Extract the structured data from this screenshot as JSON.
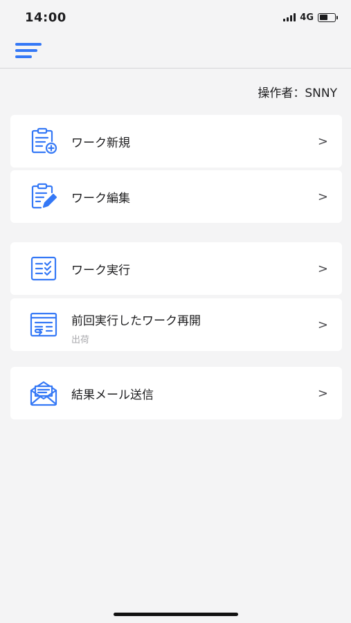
{
  "status_bar": {
    "time": "14:00",
    "network": "4G",
    "battery_level": 0.55
  },
  "header": {
    "operator_text": "操作者：SNNY",
    "menu_icon": "hamburger-menu-icon"
  },
  "menu": {
    "new_work": {
      "label": "ワーク新規",
      "icon": "clipboard-add-icon",
      "chevron": ">"
    },
    "edit_work": {
      "label": "ワーク編集",
      "icon": "clipboard-edit-icon",
      "chevron": ">"
    },
    "run_work": {
      "label": "ワーク実行",
      "icon": "checklist-icon",
      "chevron": ">"
    },
    "resume_work": {
      "label": "前回実行したワーク再開",
      "sub": "出荷",
      "icon": "resume-list-icon",
      "chevron": ">"
    },
    "send_mail": {
      "label": "結果メール送信",
      "icon": "mail-envelope-icon",
      "chevron": ">"
    }
  },
  "colors": {
    "accent": "#3478f6",
    "background": "#f4f4f5",
    "card": "#ffffff"
  }
}
